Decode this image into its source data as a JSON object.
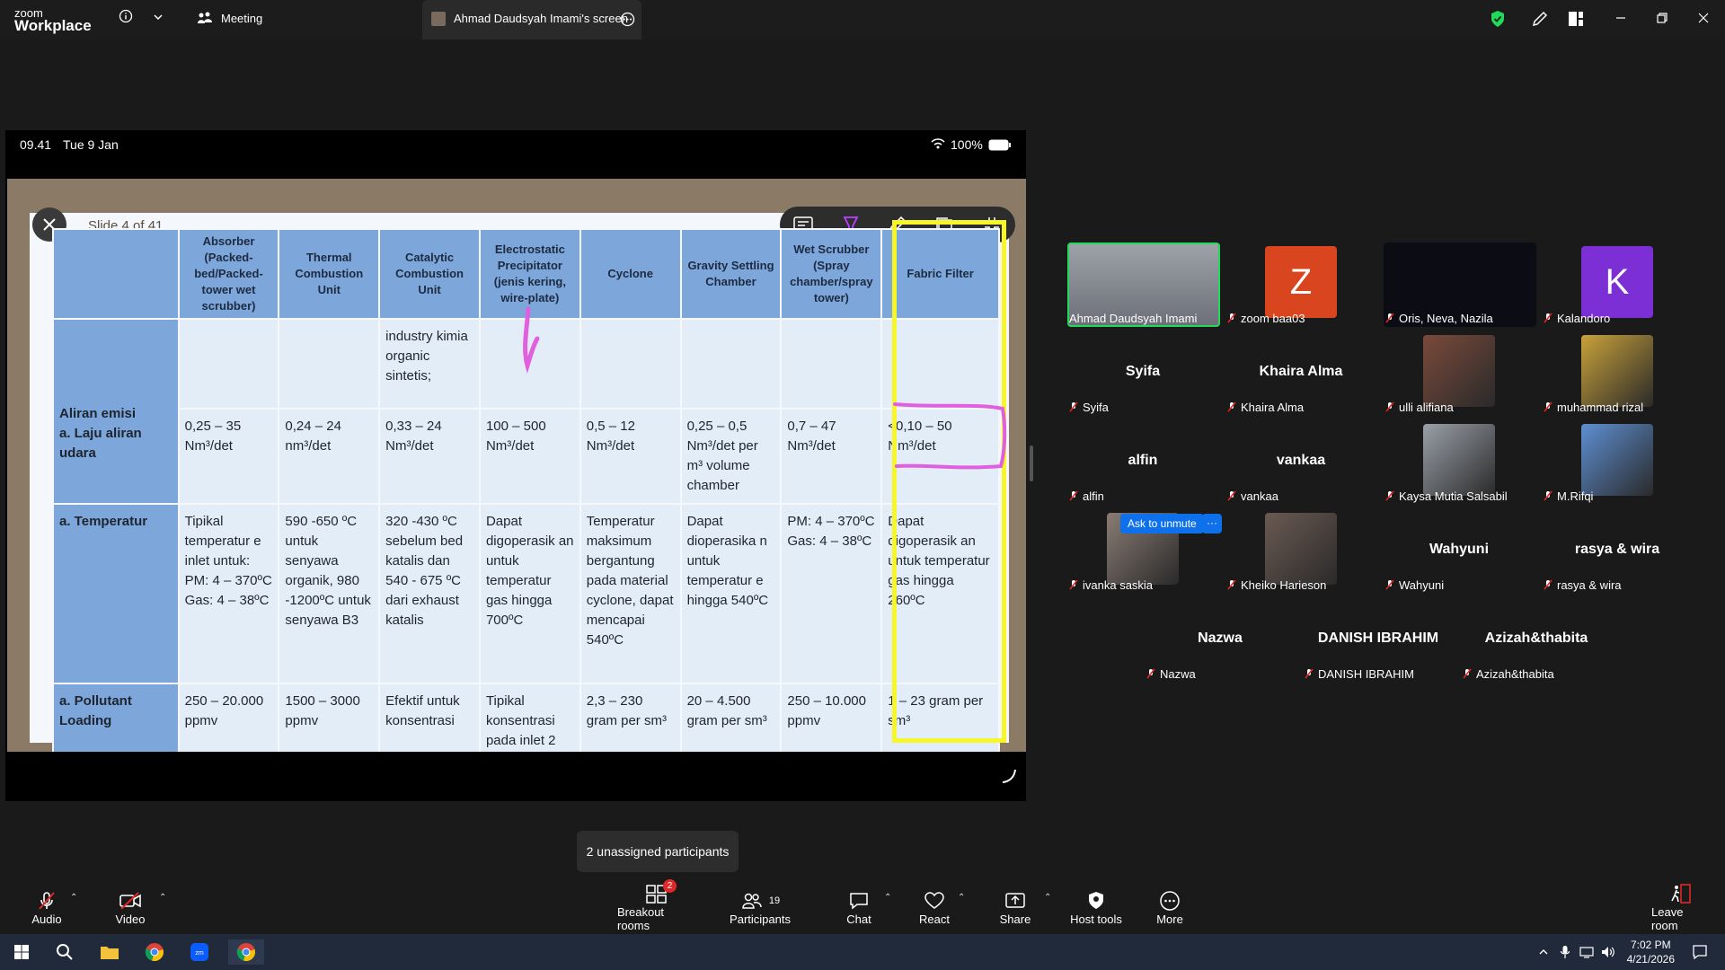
{
  "titlebar": {
    "brand_small": "zoom",
    "brand_big": "Workplace",
    "meeting_label": "Meeting",
    "screen_tab_label": "Ahmad Daudsyah Imami's screen"
  },
  "status": {
    "time": "09.41",
    "date": "Tue 9 Jan",
    "battery": "100%"
  },
  "slide": {
    "title": "Slide 4 of 41",
    "headers": [
      "Absorber (Packed-bed/Packed-tower wet scrubber)",
      "Thermal Combustion Unit",
      "Catalytic Combustion Unit",
      "Electrostatic Precipitator (jenis kering, wire-plate)",
      "Cyclone",
      "Gravity Settling Chamber",
      "Wet Scrubber (Spray chamber/spray tower)",
      "Fabric Filter"
    ],
    "row0": [
      "",
      "",
      "industry kimia organic sintetis;",
      "",
      "",
      "",
      "",
      ""
    ],
    "row1_head_1": "Aliran emisi",
    "row1_head_2": "a.  Laju aliran udara",
    "row1": [
      "0,25 – 35 Nm³/det",
      "0,24 – 24 nm³/det",
      "0,33 – 24 Nm³/det",
      "100 – 500 Nm³/det",
      "0,5 – 12 Nm³/det",
      "0,25 – 0,5 Nm³/det per m³ volume chamber",
      "0,7 – 47 Nm³/det",
      "<0,10 – 50 Nm³/det"
    ],
    "row2_head": "a.  Temperatur",
    "row2": [
      "Tipikal temperatur e inlet untuk: PM: 4 – 370ºC Gas: 4 – 38ºC",
      "590 -650 ºC untuk senyawa organik, 980 -1200ºC untuk senyawa B3",
      "320 -430 ºC sebelum bed katalis dan 540 - 675 ºC dari exhaust katalis",
      "Dapat digoperasik an untuk temperatur gas hingga 700ºC",
      "Temperatur maksimum bergantung pada material cyclone, dapat mencapai 540ºC",
      "Dapat dioperasika n untuk temperatur e hingga 540ºC",
      "PM: 4 – 370ºC Gas: 4 – 38ºC",
      "Dapat digoperasik an untuk temperatur gas hingga 260ºC"
    ],
    "row3_head": "a.  Pollutant Loading",
    "row3": [
      "250 – 20.000 ppmv",
      "1500 – 3000 ppmv",
      "Efektif untuk konsentrasi",
      "Tipikal konsentrasi pada inlet 2",
      "2,3 – 230 gram per sm³",
      "20 – 4.500 gram per sm³",
      "250 – 10.000 ppmv",
      "1 – 23 gram per sm³"
    ]
  },
  "participants": [
    {
      "big": "",
      "label": "Ahmad Daudsyah Imami",
      "muted": false
    },
    {
      "big": "Z",
      "label": "zoom baa03",
      "muted": true
    },
    {
      "big": "",
      "label": "Oris, Neva, Nazila",
      "muted": true
    },
    {
      "big": "K",
      "label": "Kalandoro",
      "muted": true
    },
    {
      "big": "Syifa",
      "label": "Syifa",
      "muted": true
    },
    {
      "big": "Khaira Alma",
      "label": "Khaira Alma",
      "muted": true
    },
    {
      "big": "",
      "label": "ulli alifiana",
      "muted": true
    },
    {
      "big": "",
      "label": "muhammad rizal",
      "muted": true
    },
    {
      "big": "alfin",
      "label": "alfin",
      "muted": true
    },
    {
      "big": "vankaa",
      "label": "vankaa",
      "muted": true
    },
    {
      "big": "",
      "label": "Kaysa Mutia Salsabil",
      "muted": true
    },
    {
      "big": "",
      "label": "M.Rifqi",
      "muted": true
    },
    {
      "big": "",
      "label": "ivanka saskia",
      "muted": true
    },
    {
      "big": "",
      "label": "Kheiko Harieson",
      "muted": true
    },
    {
      "big": "Wahyuni",
      "label": "Wahyuni",
      "muted": true
    },
    {
      "big": "rasya & wira",
      "label": "rasya & wira",
      "muted": true
    },
    {
      "big": "Nazwa",
      "label": "Nazwa",
      "muted": true
    },
    {
      "big": "DANISH IBRAHIM",
      "label": "DANISH IBRAHIM",
      "muted": true
    },
    {
      "big": "Azizah&thabita",
      "label": "Azizah&thabita",
      "muted": true
    }
  ],
  "unmute_tip": "Ask to unmute",
  "unmute_more": "···",
  "unassigned": "2 unassigned participants",
  "toolbar": {
    "audio": "Audio",
    "video": "Video",
    "breakout": "Breakout rooms",
    "breakout_badge": "2",
    "participants": "Participants",
    "participants_count": "19",
    "chat": "Chat",
    "react": "React",
    "share": "Share",
    "host_tools": "Host tools",
    "more": "More",
    "leave": "Leave room"
  },
  "taskbar": {
    "time": "7:02 PM",
    "date": "4/21/2026"
  },
  "colors": {
    "accent_blue": "#0e71eb",
    "muted_red": "#e02828",
    "highlight_yellow": "#f6f628",
    "active_speaker_green": "#23d959"
  }
}
